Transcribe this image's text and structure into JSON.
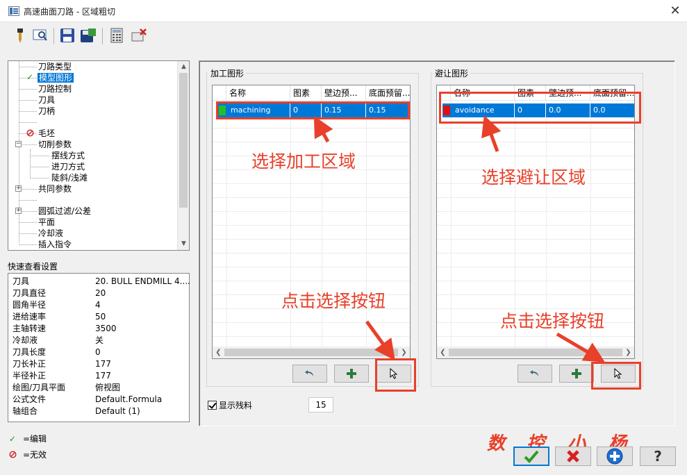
{
  "window": {
    "title": "高速曲面刀路 - 区域粗切"
  },
  "tree": {
    "items": [
      {
        "label": "刀路类型",
        "status": ""
      },
      {
        "label": "模型图形",
        "status": "edit",
        "selected": true
      },
      {
        "label": "刀路控制",
        "status": ""
      },
      {
        "label": "刀具",
        "status": ""
      },
      {
        "label": "刀柄",
        "status": ""
      },
      {
        "label": "",
        "status": ""
      },
      {
        "label": "毛坯",
        "status": "disabled"
      },
      {
        "label": "切削参数",
        "status": "",
        "expander": "-"
      },
      {
        "label": "摆线方式",
        "status": ""
      },
      {
        "label": "进刀方式",
        "status": ""
      },
      {
        "label": "陡斜/浅滩",
        "status": ""
      },
      {
        "label": "共同参数",
        "status": "",
        "expander": "+"
      },
      {
        "label": "",
        "status": ""
      },
      {
        "label": "圆弧过滤/公差",
        "status": "",
        "expander": "+"
      },
      {
        "label": "平面",
        "status": ""
      },
      {
        "label": "冷却液",
        "status": ""
      },
      {
        "label": "插入指令",
        "status": ""
      }
    ]
  },
  "quick_view": {
    "title": "快速查看设置",
    "rows": [
      {
        "key": "刀具",
        "value": "20. BULL ENDMILL 4...."
      },
      {
        "key": "刀具直径",
        "value": "20"
      },
      {
        "key": "圆角半径",
        "value": "4"
      },
      {
        "key": "进给速率",
        "value": "50"
      },
      {
        "key": "主轴转速",
        "value": "3500"
      },
      {
        "key": "冷却液",
        "value": "关"
      },
      {
        "key": "刀具长度",
        "value": "0"
      },
      {
        "key": "刀长补正",
        "value": "177"
      },
      {
        "key": "半径补正",
        "value": "177"
      },
      {
        "key": "绘图/刀具平面",
        "value": "俯视图"
      },
      {
        "key": "公式文件",
        "value": "Default.Formula"
      },
      {
        "key": "轴组合",
        "value": "Default (1)"
      }
    ]
  },
  "legend": {
    "edit": "=编辑",
    "disabled": "=无效"
  },
  "machining_group": {
    "title": "加工图形",
    "columns": [
      "名称",
      "图素",
      "壁边预...",
      "底面预留..."
    ],
    "row": {
      "color": "#22c022",
      "name": "machining",
      "entities": "0",
      "wall": "0.15",
      "floor": "0.15"
    }
  },
  "avoid_group": {
    "title": "避让图形",
    "columns": [
      "名称",
      "图素",
      "壁边预...",
      "底面预留..."
    ],
    "row": {
      "color": "#e01010",
      "name": "avoidance",
      "entities": "0",
      "wall": "0.0",
      "floor": "0.0"
    }
  },
  "annotations": {
    "select_machining": "选择加工区域",
    "select_avoid": "选择避让区域",
    "click_select_1": "点击选择按钮",
    "click_select_2": "点击选择按钮"
  },
  "show_remain": {
    "label": "显示残料",
    "checked": true,
    "value": "15"
  },
  "brand": [
    "数",
    "控",
    "小",
    "杨"
  ],
  "colors": {
    "accent": "#0078d7",
    "annotation": "#e8402a"
  }
}
